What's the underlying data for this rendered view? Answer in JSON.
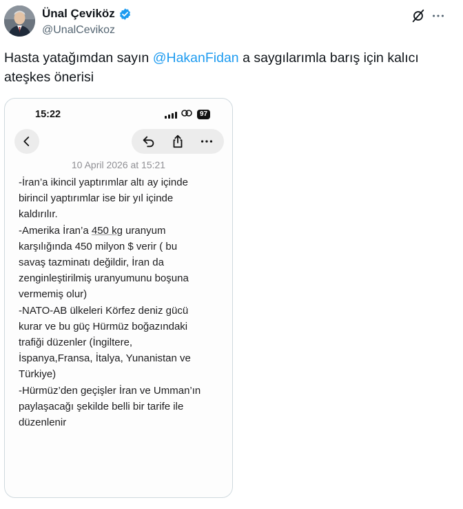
{
  "tweet": {
    "author_name": "Ünal Çeviköz",
    "author_handle": "@UnalCevikoz",
    "text_before_mention": "Hasta yatağımdan sayın ",
    "mention": "@HakanFidan",
    "text_after_mention": " a saygılarımla barış için kalıcı ateşkes önerisi"
  },
  "phone": {
    "status_time": "15:22",
    "battery": "97",
    "note_date": "10 April 2026 at 15:21",
    "note_lines": [
      {
        "parts": [
          "-İran’a ikincil yaptırımlar altı ay içinde"
        ]
      },
      {
        "parts": [
          "birincil yaptırımlar ise bir yıl içinde"
        ]
      },
      {
        "parts": [
          "kaldırılır."
        ]
      },
      {
        "parts": [
          "-Amerika İran’a ",
          "450 kg",
          " uranyum"
        ]
      },
      {
        "parts": [
          "karşılığında 450 milyon $ verir (  bu"
        ]
      },
      {
        "parts": [
          "savaş tazminatı değildir, İran da"
        ]
      },
      {
        "parts": [
          "zenginleştirilmiş uranyumunu boşuna"
        ]
      },
      {
        "parts": [
          "vermemiş olur)"
        ]
      },
      {
        "parts": [
          "-NATO-AB  ülkeleri Körfez deniz gücü"
        ]
      },
      {
        "parts": [
          "kurar ve bu güç Hürmüz boğazındaki"
        ]
      },
      {
        "parts": [
          "trafiği düzenler (İngiltere,"
        ]
      },
      {
        "parts": [
          "İspanya,Fransa, İtalya, Yunanistan ve"
        ]
      },
      {
        "parts": [
          "Türkiye)"
        ]
      },
      {
        "parts": [
          "-Hürmüz’den geçişler İran ve Umman’ın"
        ]
      },
      {
        "parts": [
          "paylaşacağı şekilde belli bir tarife ile"
        ]
      },
      {
        "parts": [
          "düzenlenir"
        ]
      }
    ]
  },
  "icons": {
    "verified": "verified-badge-icon",
    "grok": "grok-icon",
    "more": "more-icon",
    "back": "chevron-left-icon",
    "undo": "undo-icon",
    "share": "share-icon",
    "note_more": "ellipsis-icon"
  },
  "colors": {
    "link": "#1d9bf0",
    "secondary_text": "#536471",
    "primary_text": "#0f1419"
  }
}
